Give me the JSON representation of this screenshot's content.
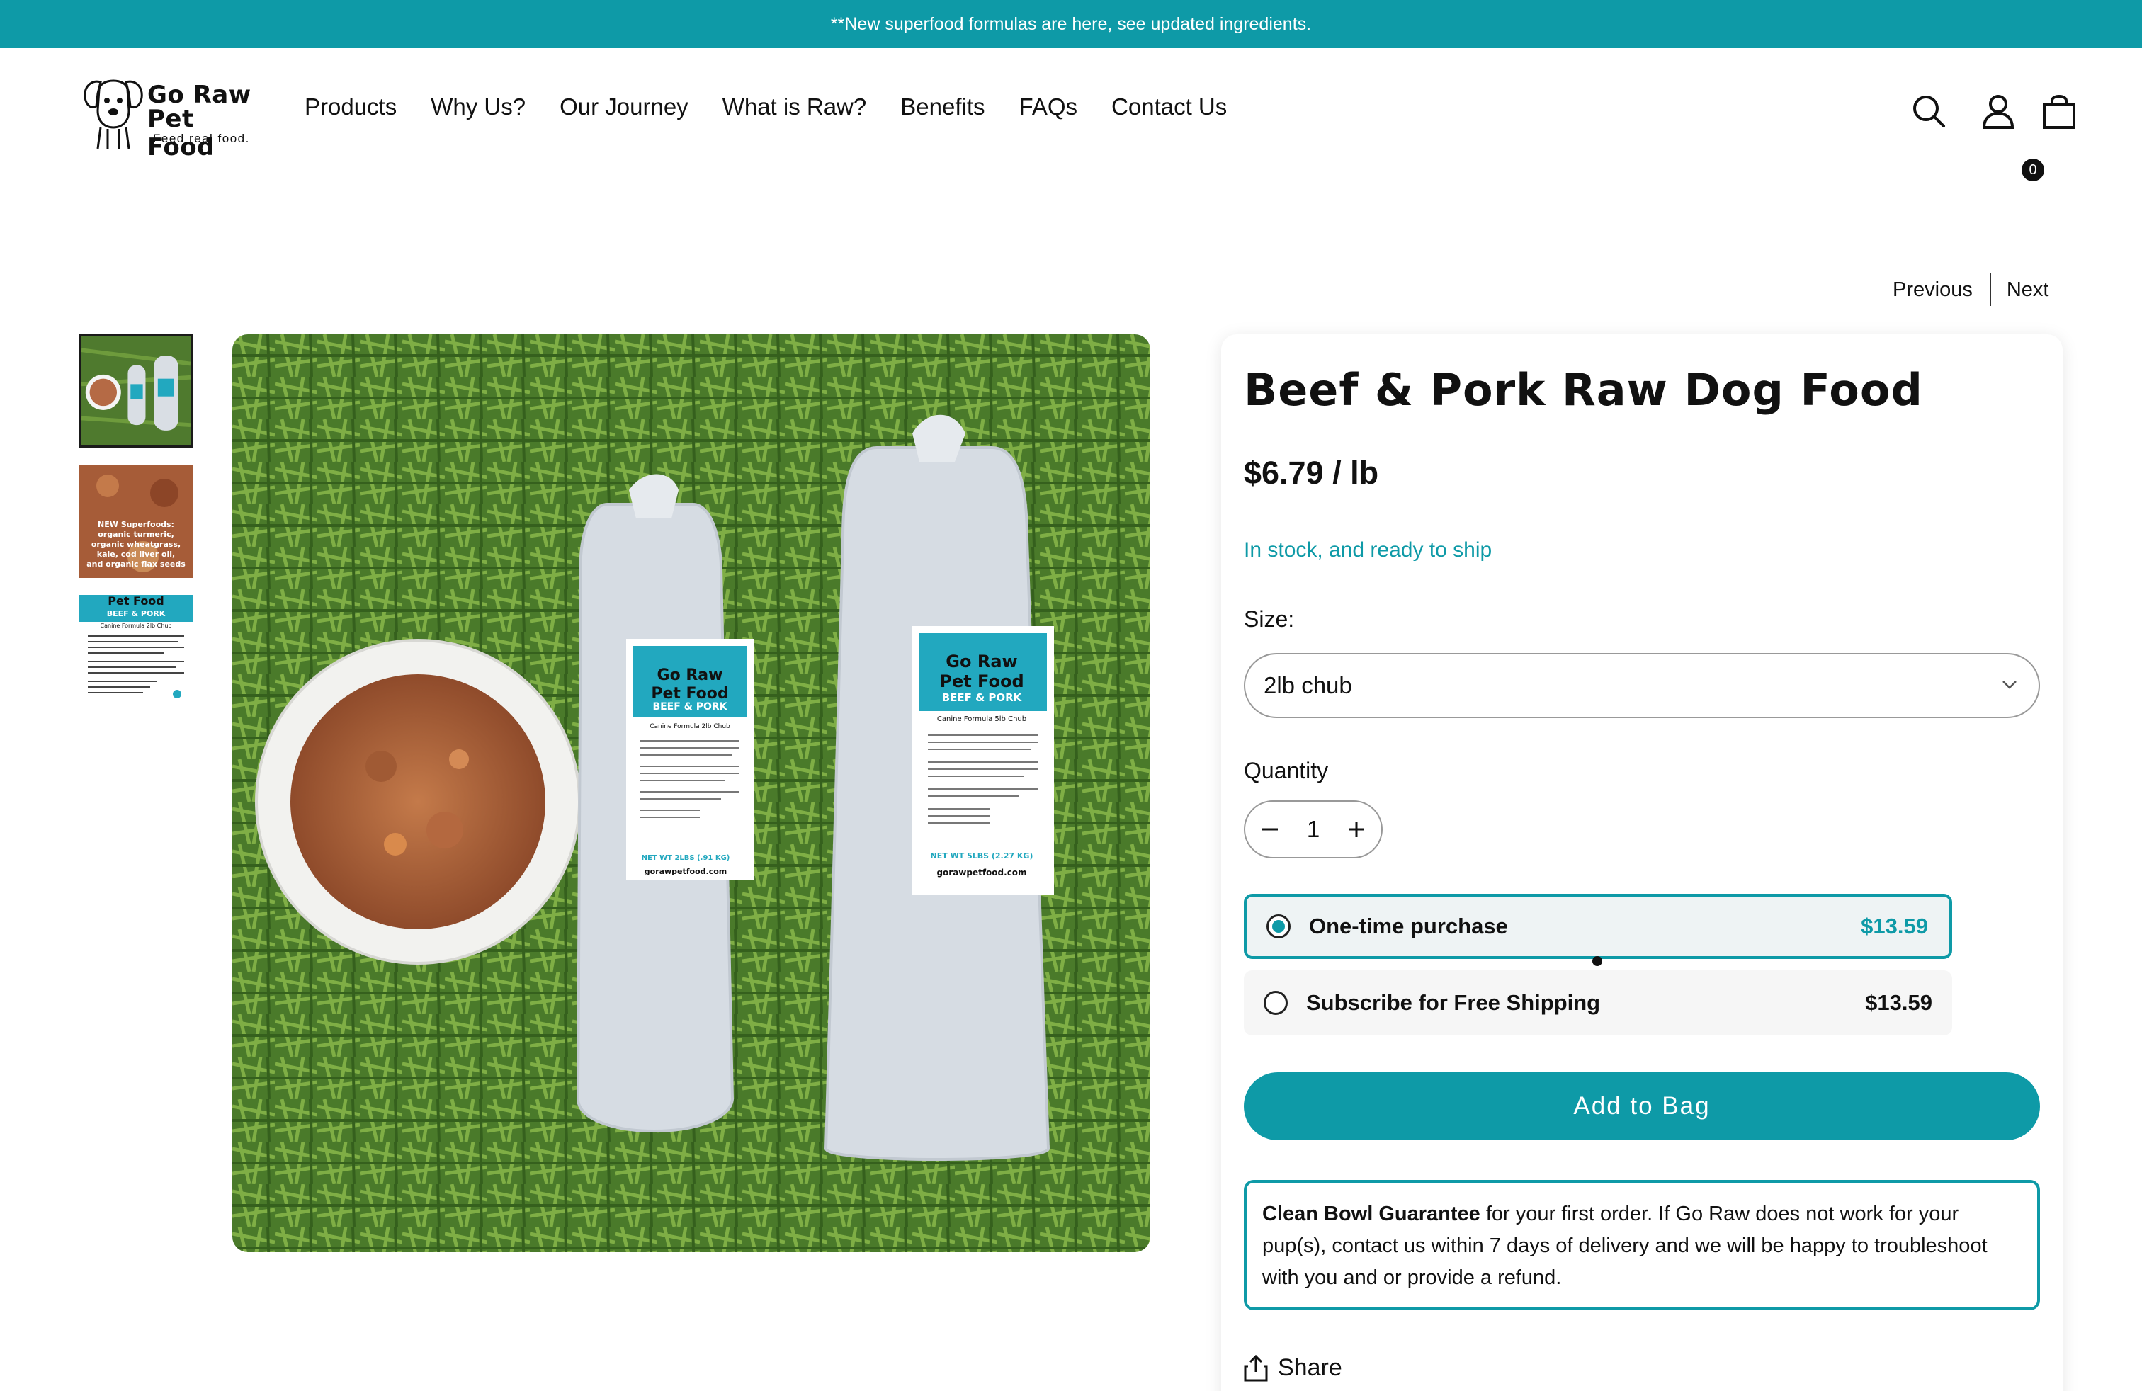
{
  "announcement": "**New superfood formulas are here, see updated ingredients.",
  "logo": {
    "line1": "Go Raw",
    "line2": "Pet Food",
    "tagline": "Feed real food."
  },
  "nav": [
    "Products",
    "Why Us?",
    "Our Journey",
    "What is Raw?",
    "Benefits",
    "FAQs",
    "Contact Us"
  ],
  "header_icons": [
    "search-icon",
    "account-icon",
    "bag-icon"
  ],
  "cart_count": "0",
  "pagination": {
    "previous": "Previous",
    "next": "Next"
  },
  "thumb_text": {
    "thumb2": [
      "NEW Superfoods:",
      "organic turmeric,",
      "organic wheatgrass,",
      "kale, cod liver oil,",
      "and organic flax seeds"
    ],
    "thumb3_header": "Pet Food",
    "thumb3_title": "BEEF & PORK",
    "thumb3_sub": "Canine Formula 2lb Chub"
  },
  "image_labels": {
    "brand1": "Go Raw",
    "brand2": "Pet Food",
    "product": "BEEF & PORK",
    "small_sub": "Canine Formula 2lb Chub",
    "large_sub": "Canine Formula 5lb Chub",
    "small_weight": "NET WT 2LBS (.91 KG)",
    "large_weight": "NET WT 5LBS (2.27 KG)",
    "website": "gorawpetfood.com"
  },
  "product": {
    "title": "Beef & Pork Raw Dog Food",
    "price": "$6.79 / lb",
    "stock": "In stock, and ready to ship",
    "size_label": "Size:",
    "size_value": "2lb chub",
    "quantity_label": "Quantity",
    "quantity": "1",
    "options": [
      {
        "label": "One-time purchase",
        "price": "$13.59"
      },
      {
        "label": "Subscribe for Free Shipping",
        "price": "$13.59"
      }
    ],
    "add_to_bag": "Add to Bag",
    "guarantee_bold": "Clean Bowl Guarantee",
    "guarantee_text": " for your first order. If Go Raw does not work for your pup(s), contact us within 7 days of delivery and we will be happy to troubleshoot with you and or provide a refund.",
    "share": "Share"
  },
  "colors": {
    "accent": "#0e9aa7",
    "text": "#111111"
  }
}
